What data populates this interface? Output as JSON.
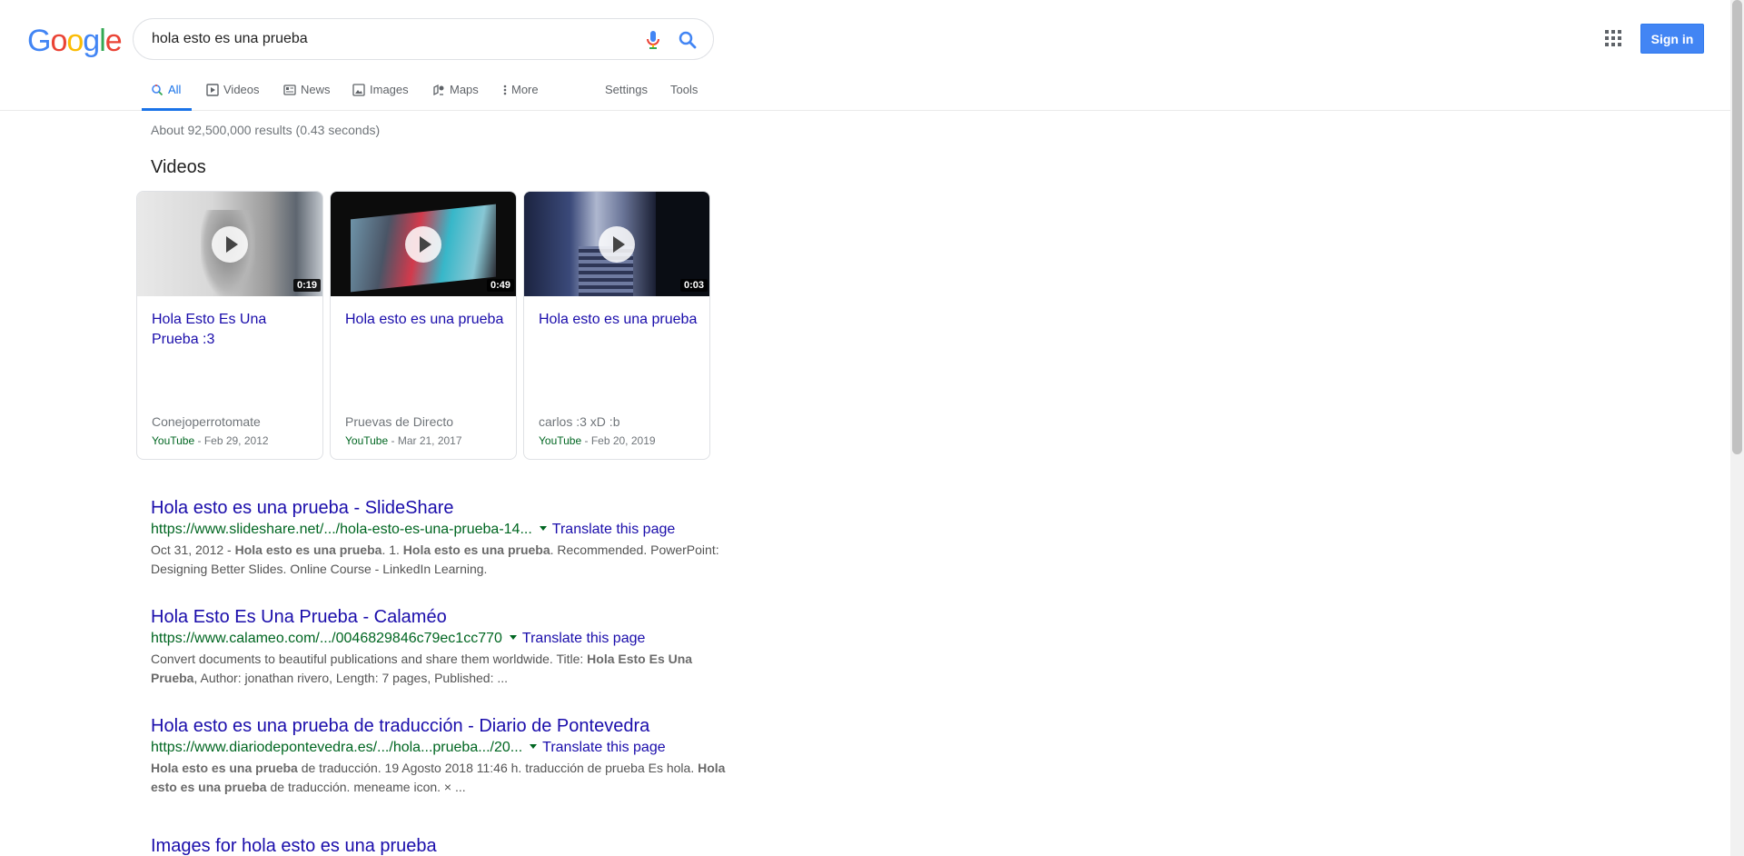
{
  "header": {
    "logo_letters": [
      "G",
      "o",
      "o",
      "g",
      "l",
      "e"
    ],
    "logo_colors": [
      "#4285F4",
      "#EA4335",
      "#FBBC05",
      "#4285F4",
      "#34A853",
      "#EA4335"
    ],
    "search_value": "hola esto es una prueba",
    "mic_icon": "microphone-icon",
    "search_icon": "magnifier-icon",
    "apps_icon": "apps-grid-icon",
    "signin_label": "Sign in"
  },
  "tabs": [
    {
      "label": "All",
      "icon": "search-icon",
      "active": true
    },
    {
      "label": "Videos",
      "icon": "video-icon"
    },
    {
      "label": "News",
      "icon": "news-icon"
    },
    {
      "label": "Images",
      "icon": "image-icon"
    },
    {
      "label": "Maps",
      "icon": "map-icon"
    },
    {
      "label": "More",
      "icon": "more-vertical-icon"
    },
    {
      "label": "Settings"
    },
    {
      "label": "Tools"
    }
  ],
  "stats": "About 92,500,000 results (0.43 seconds)",
  "videos": {
    "heading": "Videos",
    "items": [
      {
        "title": "Hola Esto Es Una Prueba :3",
        "duration": "0:19",
        "channel": "Conejoperrotomate",
        "source": "YouTube",
        "date": " - Feb 29, 2012"
      },
      {
        "title": "Hola esto es una prueba",
        "duration": "0:49",
        "channel": "Pruevas de Directo",
        "source": "YouTube",
        "date": " - Mar 21, 2017"
      },
      {
        "title": "Hola esto es una prueba",
        "duration": "0:03",
        "channel": "carlos :3 xD :b",
        "source": "YouTube",
        "date": " - Feb 20, 2019"
      }
    ]
  },
  "results": [
    {
      "title": "Hola esto es una prueba - SlideShare",
      "url": "https://www.slideshare.net/.../hola-esto-es-una-prueba-14...",
      "translate": "Translate this page",
      "snippet": [
        {
          "t": "Oct 31, 2012 - ",
          "b": false
        },
        {
          "t": "Hola esto es una prueba",
          "b": true
        },
        {
          "t": ". 1. ",
          "b": false
        },
        {
          "t": "Hola esto es una prueba",
          "b": true
        },
        {
          "t": ". Recommended. PowerPoint: Designing Better Slides. Online Course - LinkedIn Learning.",
          "b": false
        }
      ]
    },
    {
      "title": "Hola Esto Es Una Prueba - Calaméo",
      "url": "https://www.calameo.com/.../0046829846c79ec1cc770",
      "translate": "Translate this page",
      "snippet": [
        {
          "t": "Convert documents to beautiful publications and share them worldwide. Title: ",
          "b": false
        },
        {
          "t": "Hola Esto Es Una Prueba",
          "b": true
        },
        {
          "t": ", Author: jonathan rivero, Length: 7 pages, Published: ...",
          "b": false
        }
      ]
    },
    {
      "title": "Hola esto es una prueba de traducción - Diario de Pontevedra",
      "url": "https://www.diariodepontevedra.es/.../hola...prueba.../20...",
      "translate": "Translate this page",
      "snippet": [
        {
          "t": "Hola esto es una prueba",
          "b": true
        },
        {
          "t": " de traducción. 19 Agosto 2018 11:46 h. traducción de prueba Es hola. ",
          "b": false
        },
        {
          "t": "Hola esto es una prueba",
          "b": true
        },
        {
          "t": " de traducción. meneame icon. × ...",
          "b": false
        }
      ]
    }
  ],
  "images_heading": "Images for hola esto es una prueba"
}
